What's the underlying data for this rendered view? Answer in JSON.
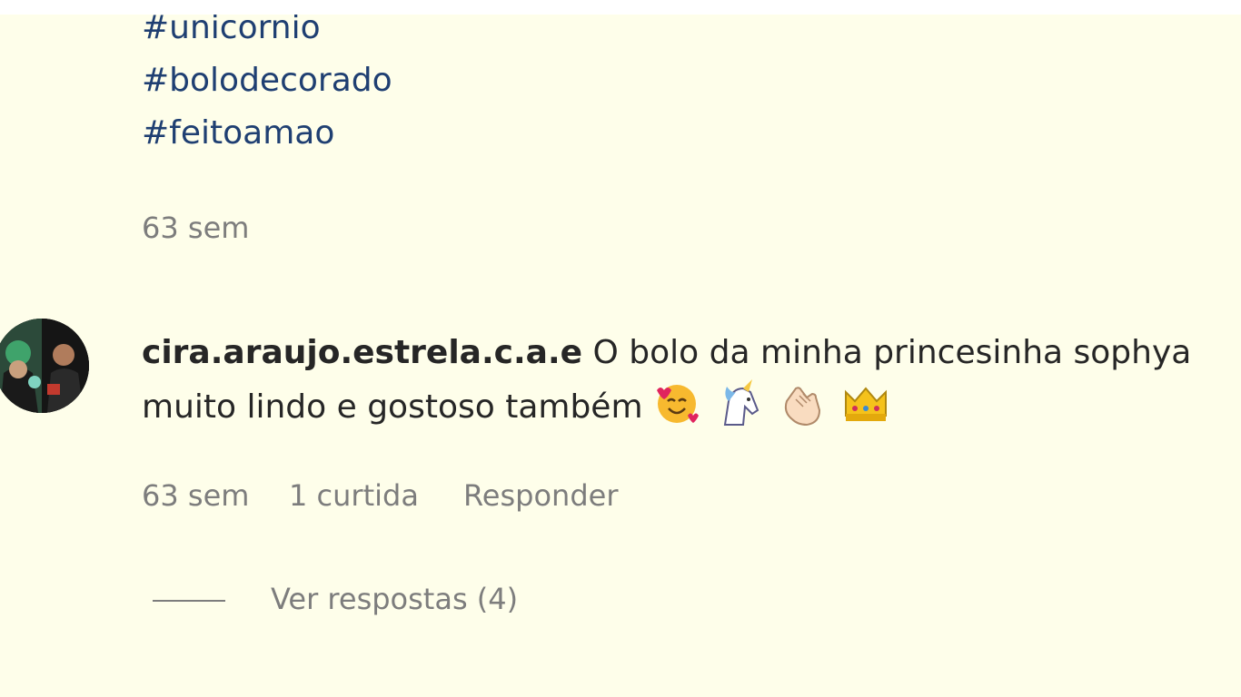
{
  "hashtags": [
    "#unicornio",
    "#bolodecorado",
    "#feitoamao"
  ],
  "caption_time": "63 sem",
  "comment": {
    "username": "cira.araujo.estrela.c.a.e",
    "text_line1": "O bolo da minha princesinha sophya",
    "text_line2": "muito lindo e gostoso também",
    "emojis": [
      "smiling-face-with-hearts",
      "unicorn",
      "clapping-hands",
      "crown"
    ],
    "time": "63 sem",
    "likes": "1 curtida",
    "reply_label": "Responder",
    "view_replies": "Ver respostas (4)"
  }
}
